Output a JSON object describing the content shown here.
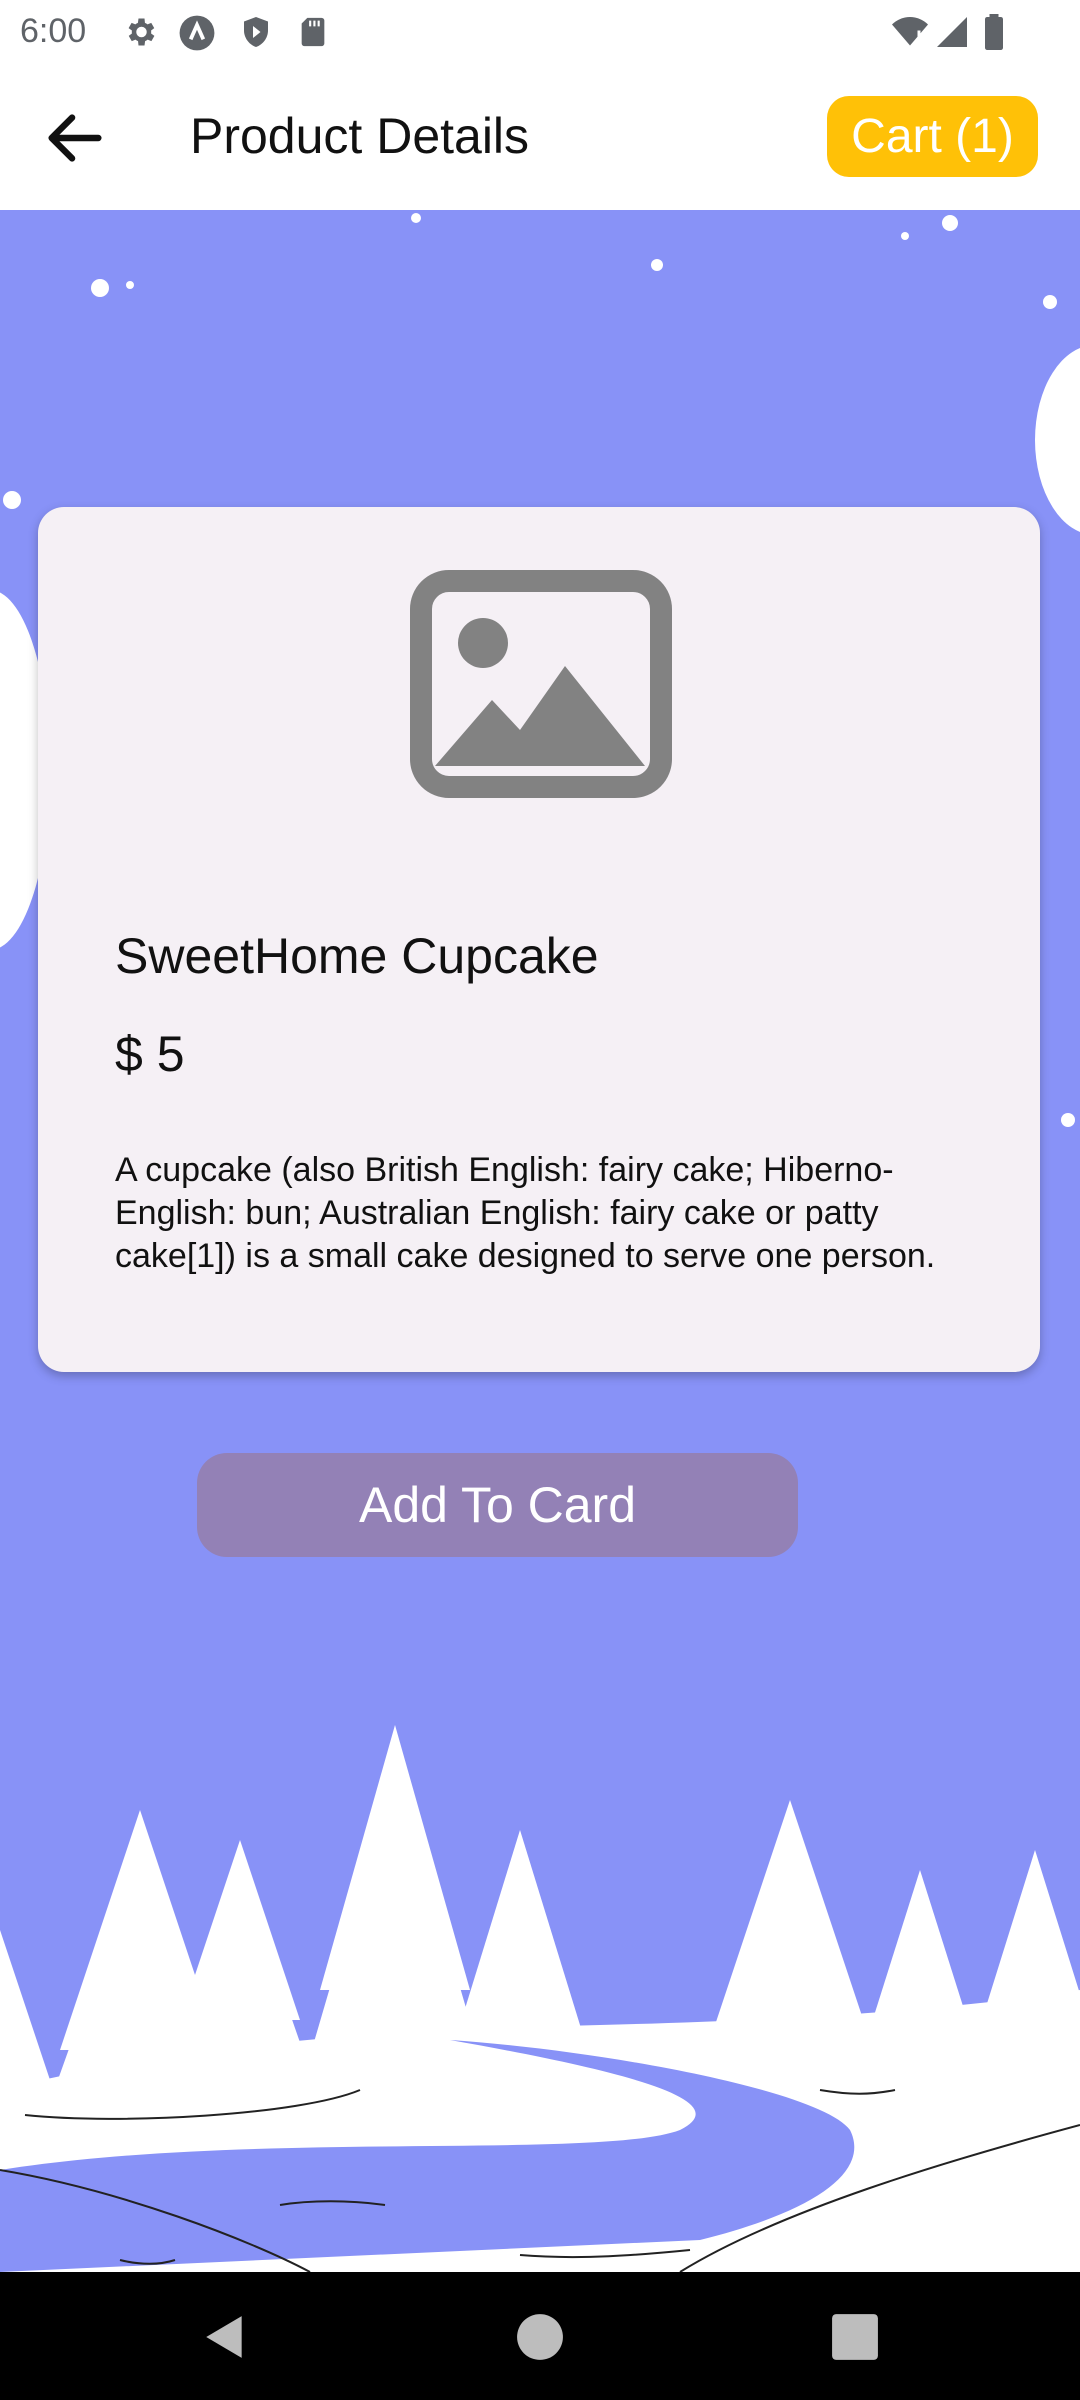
{
  "status_bar": {
    "time": "6:00",
    "icons": [
      "settings-icon",
      "a-badge-icon",
      "shield-play-icon",
      "sd-card-icon",
      "wifi-icon",
      "signal-icon",
      "battery-icon"
    ]
  },
  "app_bar": {
    "title": "Product Details",
    "cart_label": "Cart (1)",
    "back_icon": "arrow-back-icon"
  },
  "product": {
    "image_icon": "image-placeholder-icon",
    "name": "SweetHome Cupcake",
    "price": "$ 5",
    "description": "A cupcake (also British English: fairy cake; Hiberno-English: bun; Australian English: fairy cake or patty cake[1]) is a small cake designed to serve one person."
  },
  "actions": {
    "add_label": "Add To Card"
  },
  "nav_bar": {
    "buttons": [
      "back-triangle-icon",
      "home-circle-icon",
      "recents-square-icon"
    ]
  },
  "colors": {
    "accent": "#ffc107",
    "button": "#9381b6",
    "background": "#8892f7",
    "card": "#f5f0f5"
  }
}
